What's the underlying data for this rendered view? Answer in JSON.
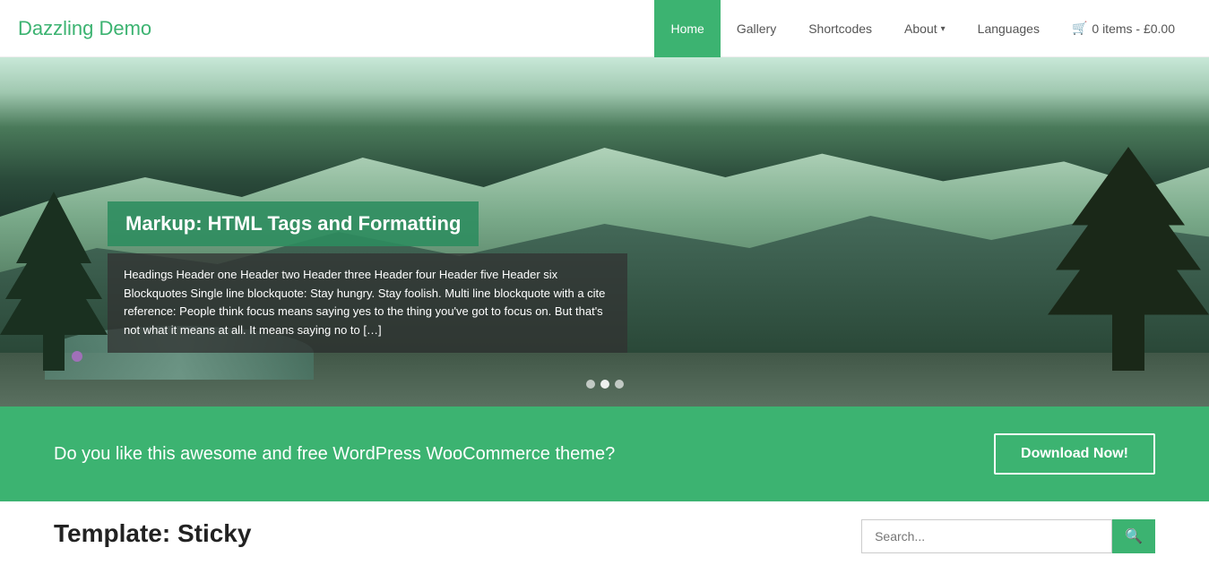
{
  "site": {
    "logo": "Dazzling Demo"
  },
  "nav": {
    "items": [
      {
        "label": "Home",
        "active": true
      },
      {
        "label": "Gallery",
        "active": false
      },
      {
        "label": "Shortcodes",
        "active": false
      },
      {
        "label": "About",
        "active": false,
        "has_dropdown": true
      },
      {
        "label": "Languages",
        "active": false
      }
    ],
    "cart": {
      "label": "0 items",
      "price": "£0.00",
      "full_label": "0 items - £0.00"
    }
  },
  "hero": {
    "slide_title": "Markup: HTML Tags and Formatting",
    "slide_description": "Headings Header one Header two Header three Header four Header five Header six Blockquotes Single line blockquote: Stay hungry. Stay foolish. Multi line blockquote with a cite reference: People think focus means saying yes to the thing you've got to focus on. But that's not what it means at all. It means saying no to […]",
    "dots": [
      {
        "state": "semi"
      },
      {
        "state": "active"
      },
      {
        "state": "semi"
      }
    ]
  },
  "cta": {
    "text": "Do you like this awesome and free WordPress WooCommerce theme?",
    "button_label": "Download Now!"
  },
  "bottom": {
    "title": "Template: Sticky",
    "search_placeholder": "Search..."
  },
  "colors": {
    "primary": "#3cb371",
    "dark_overlay": "rgba(50,50,50,0.75)",
    "title_overlay": "rgba(44,140,95,0.88)"
  }
}
